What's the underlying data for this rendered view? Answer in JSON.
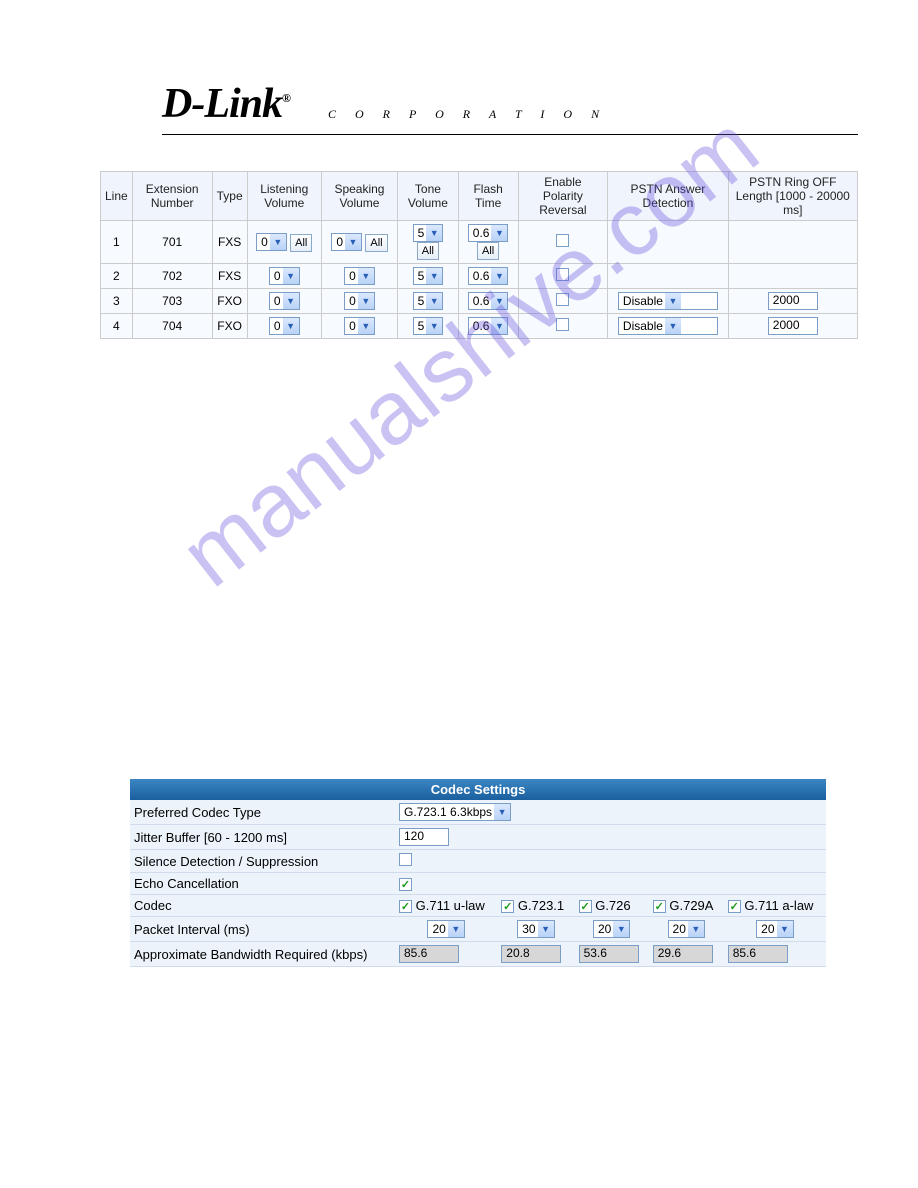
{
  "brand": {
    "logo_text": "D-Link",
    "reg": "®",
    "corp": "C O R P O R A T I O N"
  },
  "watermark": "manualshive.com",
  "top_table": {
    "headers": [
      "Line",
      "Extension Number",
      "Type",
      "Listening Volume",
      "Speaking Volume",
      "Tone Volume",
      "Flash Time",
      "Enable Polarity Reversal",
      "PSTN Answer Detection",
      "PSTN Ring OFF Length [1000 - 20000 ms]"
    ],
    "all_btn": "All",
    "rows": [
      {
        "line": "1",
        "ext": "701",
        "type": "FXS",
        "listen": "0",
        "speak": "0",
        "tone": "5",
        "flash": "0.6",
        "polarity": false,
        "pstn_answer": null,
        "pstn_ring": null,
        "show_all": true
      },
      {
        "line": "2",
        "ext": "702",
        "type": "FXS",
        "listen": "0",
        "speak": "0",
        "tone": "5",
        "flash": "0.6",
        "polarity": false,
        "pstn_answer": null,
        "pstn_ring": null,
        "show_all": false
      },
      {
        "line": "3",
        "ext": "703",
        "type": "FXO",
        "listen": "0",
        "speak": "0",
        "tone": "5",
        "flash": "0.6",
        "polarity": false,
        "pstn_answer": "Disable",
        "pstn_ring": "2000",
        "show_all": false
      },
      {
        "line": "4",
        "ext": "704",
        "type": "FXO",
        "listen": "0",
        "speak": "0",
        "tone": "5",
        "flash": "0.6",
        "polarity": false,
        "pstn_answer": "Disable",
        "pstn_ring": "2000",
        "show_all": false
      }
    ]
  },
  "codec": {
    "title": "Codec Settings",
    "labels": {
      "preferred": "Preferred Codec Type",
      "jitter": "Jitter Buffer [60 - 1200 ms]",
      "silence": "Silence Detection / Suppression",
      "echo": "Echo Cancellation",
      "codec": "Codec",
      "packet": "Packet Interval (ms)",
      "bandwidth": "Approximate Bandwidth Required (kbps)"
    },
    "preferred_value": "G.723.1 6.3kbps",
    "jitter_value": "120",
    "silence_checked": false,
    "echo_checked": true,
    "codecs": [
      {
        "name": "G.711 u-law",
        "checked": true,
        "packet": "20",
        "bw": "85.6"
      },
      {
        "name": "G.723.1",
        "checked": true,
        "packet": "30",
        "bw": "20.8"
      },
      {
        "name": "G.726",
        "checked": true,
        "packet": "20",
        "bw": "53.6"
      },
      {
        "name": "G.729A",
        "checked": true,
        "packet": "20",
        "bw": "29.6"
      },
      {
        "name": "G.711 a-law",
        "checked": true,
        "packet": "20",
        "bw": "85.6"
      }
    ]
  }
}
